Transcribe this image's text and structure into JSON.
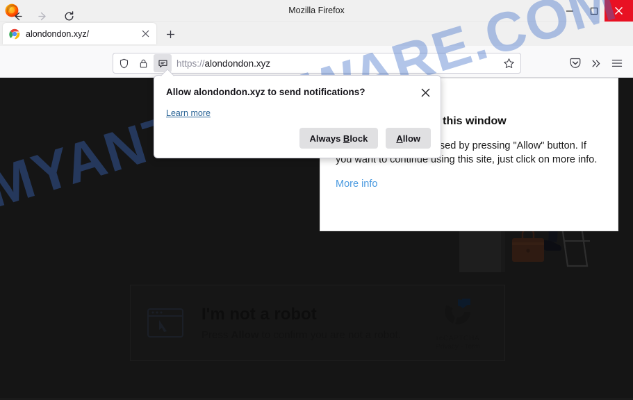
{
  "window": {
    "title": "Mozilla Firefox",
    "controls": {
      "minimize": "minimize-button",
      "maximize": "maximize-button",
      "close": "close-button"
    },
    "close_color": "#e81123"
  },
  "tabs": [
    {
      "title": "alondondon.xyz/",
      "favicon": "chrome-circle-icon",
      "close_label": "Close tab"
    }
  ],
  "newtab_label": "Open a new tab",
  "toolbar": {
    "back": "Go back one page",
    "forward": "Go forward one page",
    "reload": "Reload current page",
    "bookmark": "Bookmark this page",
    "pocket": "Save to Pocket",
    "overflow": "More tools",
    "appmenu": "Open application menu"
  },
  "urlbar": {
    "scheme": "https://",
    "host": "alondondon.xyz",
    "full_value": "https://alondondon.xyz",
    "icons": [
      "shield-icon",
      "lock-icon",
      "notification-permission-icon"
    ]
  },
  "doorhanger": {
    "title": "Allow alondondon.xyz to send notifications?",
    "learn_more": "Learn more",
    "block_label_pre": "Always ",
    "block_label_key": "B",
    "block_label_post": "lock",
    "allow_label_key": "A",
    "allow_label_post": "llow",
    "close": "Close"
  },
  "page": {
    "background": "#2f2f2f",
    "watermark": "MYANTISPYWARE.COM",
    "watermark_color": "#3e6ec8",
    "captcha": {
      "heading": "I'm not a robot",
      "body_pre": "Press ",
      "body_strong": "Allow",
      "body_post": " to confirm you are not a robot.",
      "brand": "reCAPTCHA",
      "brand_sub": "Privacy - Term",
      "icon": "browser-window-cursor-icon"
    },
    "info_panel": {
      "heading": "Click Allow to close this window",
      "body": "This window can be closed by pressing \"Allow\" button. If you want to continue using this site, just click on more info.",
      "link": "More info"
    }
  }
}
